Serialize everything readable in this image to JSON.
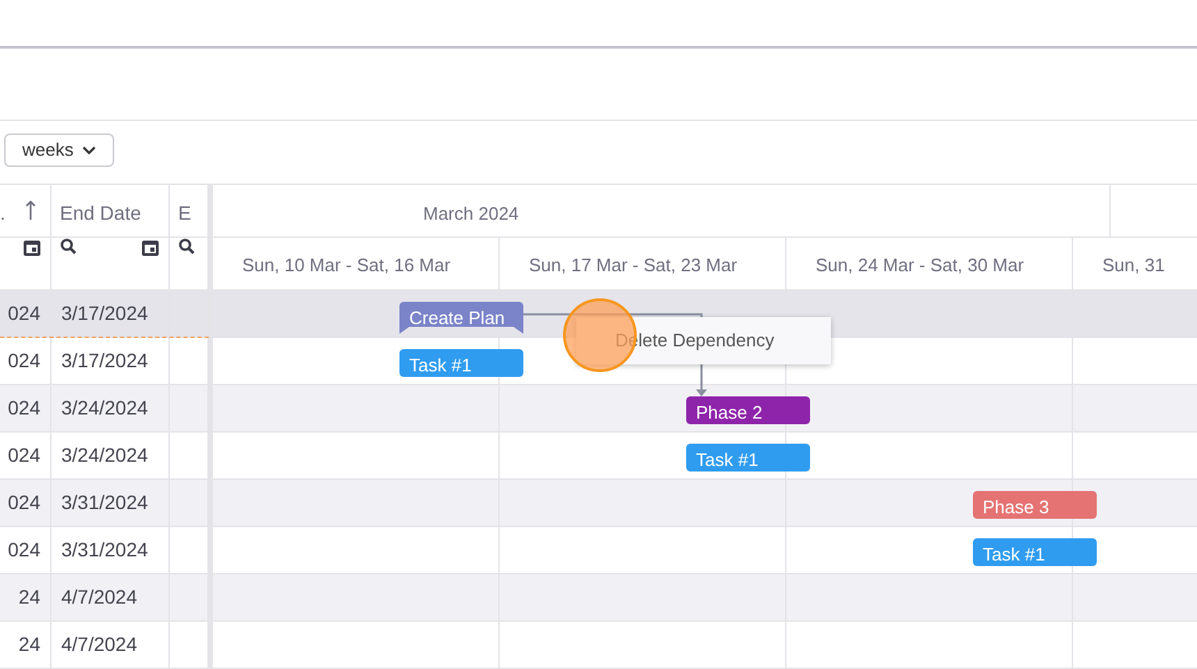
{
  "toolbar": {
    "zoom_dropdown": "weeks"
  },
  "grid": {
    "columns": [
      {
        "label": ".",
        "kind": "date_partial",
        "sorted": true
      },
      {
        "label": "End Date",
        "kind": "date",
        "sorted": false
      },
      {
        "label": "E",
        "kind": "text",
        "sorted": false
      }
    ],
    "rows": [
      {
        "cells": [
          "024",
          "3/17/2024",
          ""
        ],
        "selected": true
      },
      {
        "cells": [
          "024",
          "3/17/2024",
          ""
        ],
        "selected": false
      },
      {
        "cells": [
          "024",
          "3/24/2024",
          ""
        ],
        "selected": false
      },
      {
        "cells": [
          "024",
          "3/24/2024",
          ""
        ],
        "selected": false
      },
      {
        "cells": [
          "024",
          "3/31/2024",
          ""
        ],
        "selected": false
      },
      {
        "cells": [
          "024",
          "3/31/2024",
          ""
        ],
        "selected": false
      },
      {
        "cells": [
          "24",
          "4/7/2024",
          ""
        ],
        "selected": false
      },
      {
        "cells": [
          "24",
          "4/7/2024",
          ""
        ],
        "selected": false
      }
    ]
  },
  "timeline": {
    "month": "March 2024",
    "weeks": [
      {
        "label": "Sun, 10 Mar - Sat, 16 Mar",
        "bars": [
          {
            "label": "Create Plan",
            "kind": "summary",
            "color": "#7b83c9",
            "has_dependency": true
          },
          {
            "label": "Task #1",
            "kind": "task",
            "color": "#2f9cf0",
            "has_dependency": false
          }
        ]
      },
      {
        "label": "Sun, 17 Mar - Sat, 23 Mar",
        "bars": [
          {
            "label": "Phase 2",
            "kind": "phase",
            "color": "#8e24aa",
            "has_dependency": false
          },
          {
            "label": "Task #1",
            "kind": "task",
            "color": "#2f9cf0",
            "has_dependency": false
          }
        ]
      },
      {
        "label": "Sun, 24 Mar - Sat, 30 Mar",
        "bars": [
          {
            "label": "Phase 3",
            "kind": "phase",
            "color": "#e57373",
            "has_dependency": false
          },
          {
            "label": "Task #1",
            "kind": "task",
            "color": "#2f9cf0",
            "has_dependency": false
          }
        ]
      },
      {
        "label": "Sun, 31"
      }
    ]
  },
  "context_menu": {
    "items": [
      "Delete Dependency"
    ]
  },
  "click_marker": true
}
